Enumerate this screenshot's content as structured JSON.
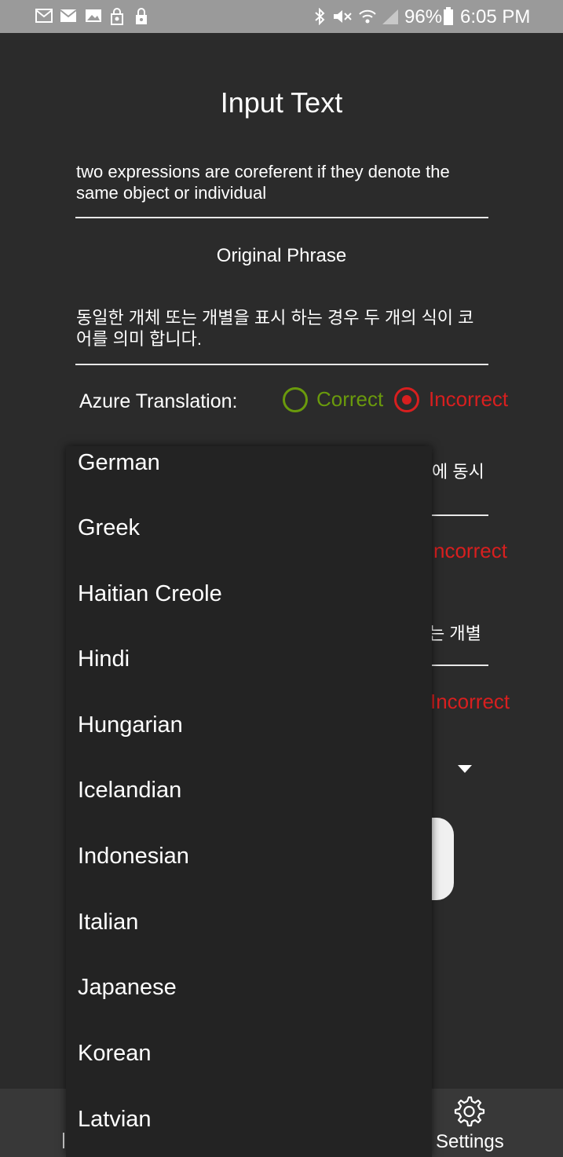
{
  "status_bar": {
    "battery_percent": "96%",
    "time": "6:05 PM"
  },
  "page": {
    "title": "Input Text",
    "input_text": "two expressions are coreferent if they denote the same object or individual",
    "original_phrase_heading": "Original Phrase",
    "korean_translation": "동일한 개체 또는 개별을 표시 하는 경우 두 개의 식이 코어를 의미 합니다.",
    "azure_label": "Azure Translation:",
    "radio_correct": "Correct",
    "radio_incorrect": "Incorrect",
    "selected_option": "Incorrect"
  },
  "background_fragments": {
    "text_1": "에 동시",
    "incorrect_1": "ncorrect",
    "text_2": "는 개별",
    "incorrect_2": "Incorrect"
  },
  "language_dropdown": {
    "options": [
      "German",
      "Greek",
      "Haitian Creole",
      "Hindi",
      "Hungarian",
      "Icelandian",
      "Indonesian",
      "Italian",
      "Japanese",
      "Korean",
      "Latvian"
    ]
  },
  "bottom_nav": {
    "settings_label": "Settings"
  },
  "colors": {
    "correct_green": "#6a9a0c",
    "incorrect_red": "#d81f1f",
    "background": "#2b2b2b",
    "popup_background": "#232323"
  }
}
